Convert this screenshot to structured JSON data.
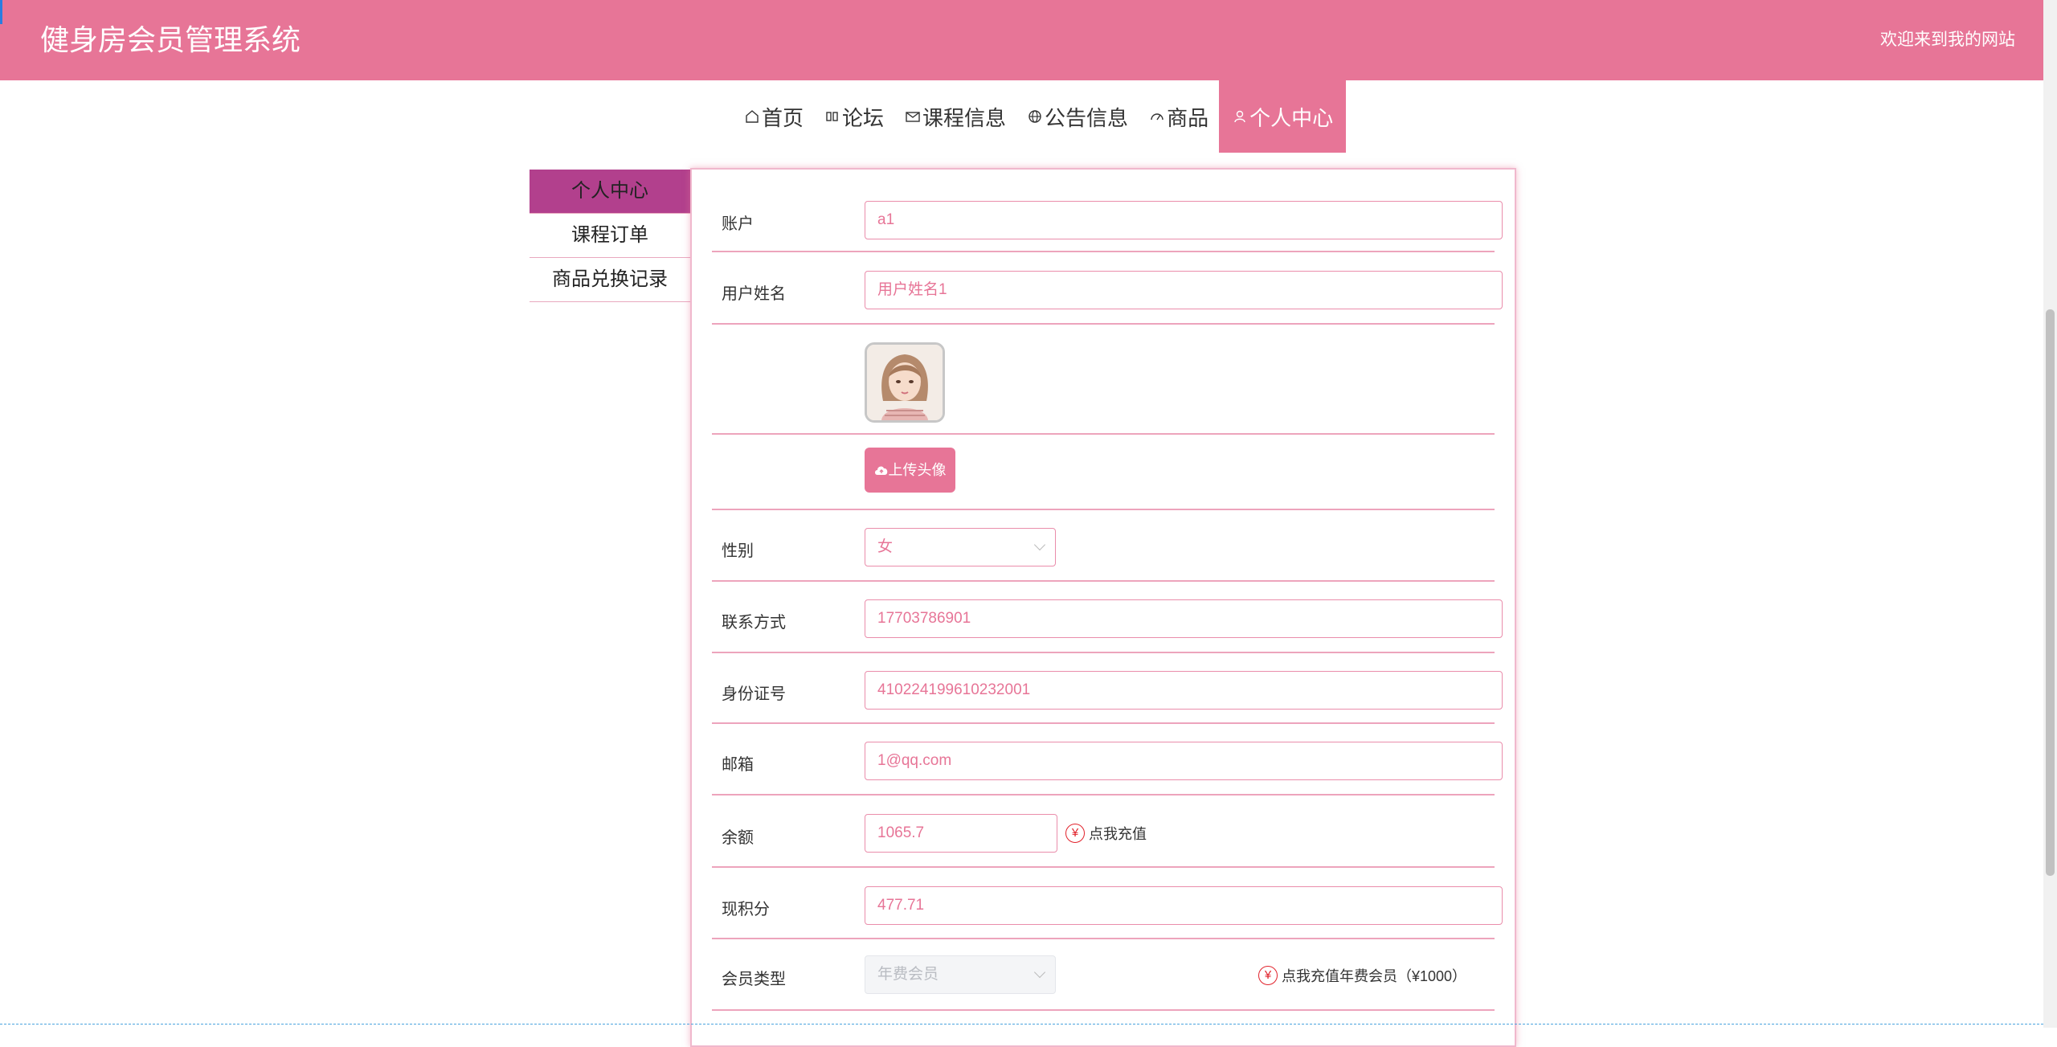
{
  "header": {
    "title": "健身房会员管理系统",
    "welcome": "欢迎来到我的网站"
  },
  "nav": {
    "items": [
      {
        "label": "首页",
        "icon": "home-icon"
      },
      {
        "label": "论坛",
        "icon": "forum-icon"
      },
      {
        "label": "课程信息",
        "icon": "mail-icon"
      },
      {
        "label": "公告信息",
        "icon": "globe-icon"
      },
      {
        "label": "商品",
        "icon": "dashboard-icon"
      },
      {
        "label": "个人中心",
        "icon": "user-icon",
        "active": true
      }
    ]
  },
  "sidebar": {
    "items": [
      {
        "label": "个人中心",
        "active": true
      },
      {
        "label": "课程订单"
      },
      {
        "label": "商品兑换记录"
      }
    ]
  },
  "form": {
    "account": {
      "label": "账户",
      "value": "a1"
    },
    "name": {
      "label": "用户姓名",
      "value": "用户姓名1"
    },
    "avatar": {
      "alt": "avatar"
    },
    "upload": {
      "label": "上传头像",
      "icon": "cloud-upload-icon"
    },
    "gender": {
      "label": "性别",
      "value": "女"
    },
    "phone": {
      "label": "联系方式",
      "value": "17703786901"
    },
    "id_card": {
      "label": "身份证号",
      "value": "410224199610232001"
    },
    "email": {
      "label": "邮箱",
      "value": "1@qq.com"
    },
    "balance": {
      "label": "余额",
      "value": "1065.7",
      "action": "点我充值"
    },
    "points": {
      "label": "现积分",
      "value": "477.71"
    },
    "member_type": {
      "label": "会员类型",
      "value": "年费会员",
      "action": "点我充值年费会员（¥1000）"
    }
  },
  "colors": {
    "primary": "#e77597",
    "sidebar_active": "#b2408d",
    "recharge_icon": "#e1222b"
  }
}
